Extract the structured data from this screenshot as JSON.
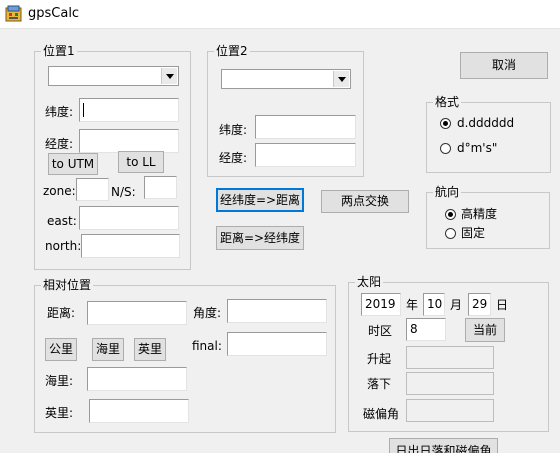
{
  "window": {
    "title": "gpsCalc"
  },
  "pos1": {
    "title": "位置1",
    "lat_label": "纬度:",
    "lon_label": "经度:",
    "to_utm": "to UTM",
    "to_ll": "to LL",
    "zone_label": "zone:",
    "ns_label": "N/S:",
    "east_label": "east:",
    "north_label": "north:"
  },
  "pos2": {
    "title": "位置2",
    "lat_label": "纬度:",
    "lon_label": "经度:"
  },
  "actions": {
    "cancel": "取消",
    "latlon_to_dist": "经纬度=>距离",
    "swap": "两点交换",
    "dist_to_latlon": "距离=>经纬度",
    "sunrise_btn": "日出日落和磁偏角"
  },
  "format": {
    "title": "格式",
    "options": [
      "d.dddddd",
      "d°m's\""
    ],
    "selected": 0
  },
  "heading": {
    "title": "航向",
    "options": [
      "高精度",
      "固定"
    ],
    "selected": 0
  },
  "relative": {
    "title": "相对位置",
    "distance_label": "距离:",
    "angle_label": "角度:",
    "final_label": "final:",
    "km_btn": "公里",
    "nm_btn": "海里",
    "mi_btn": "英里",
    "nm_label": "海里:",
    "mi_label": "英里:"
  },
  "sun": {
    "title": "太阳",
    "year": "2019",
    "year_unit": "年",
    "month": "10",
    "month_unit": "月",
    "day": "29",
    "day_unit": "日",
    "tz_label": "时区",
    "tz_value": "8",
    "now_btn": "当前",
    "rise_label": "升起",
    "set_label": "落下",
    "declination_label": "磁偏角"
  }
}
